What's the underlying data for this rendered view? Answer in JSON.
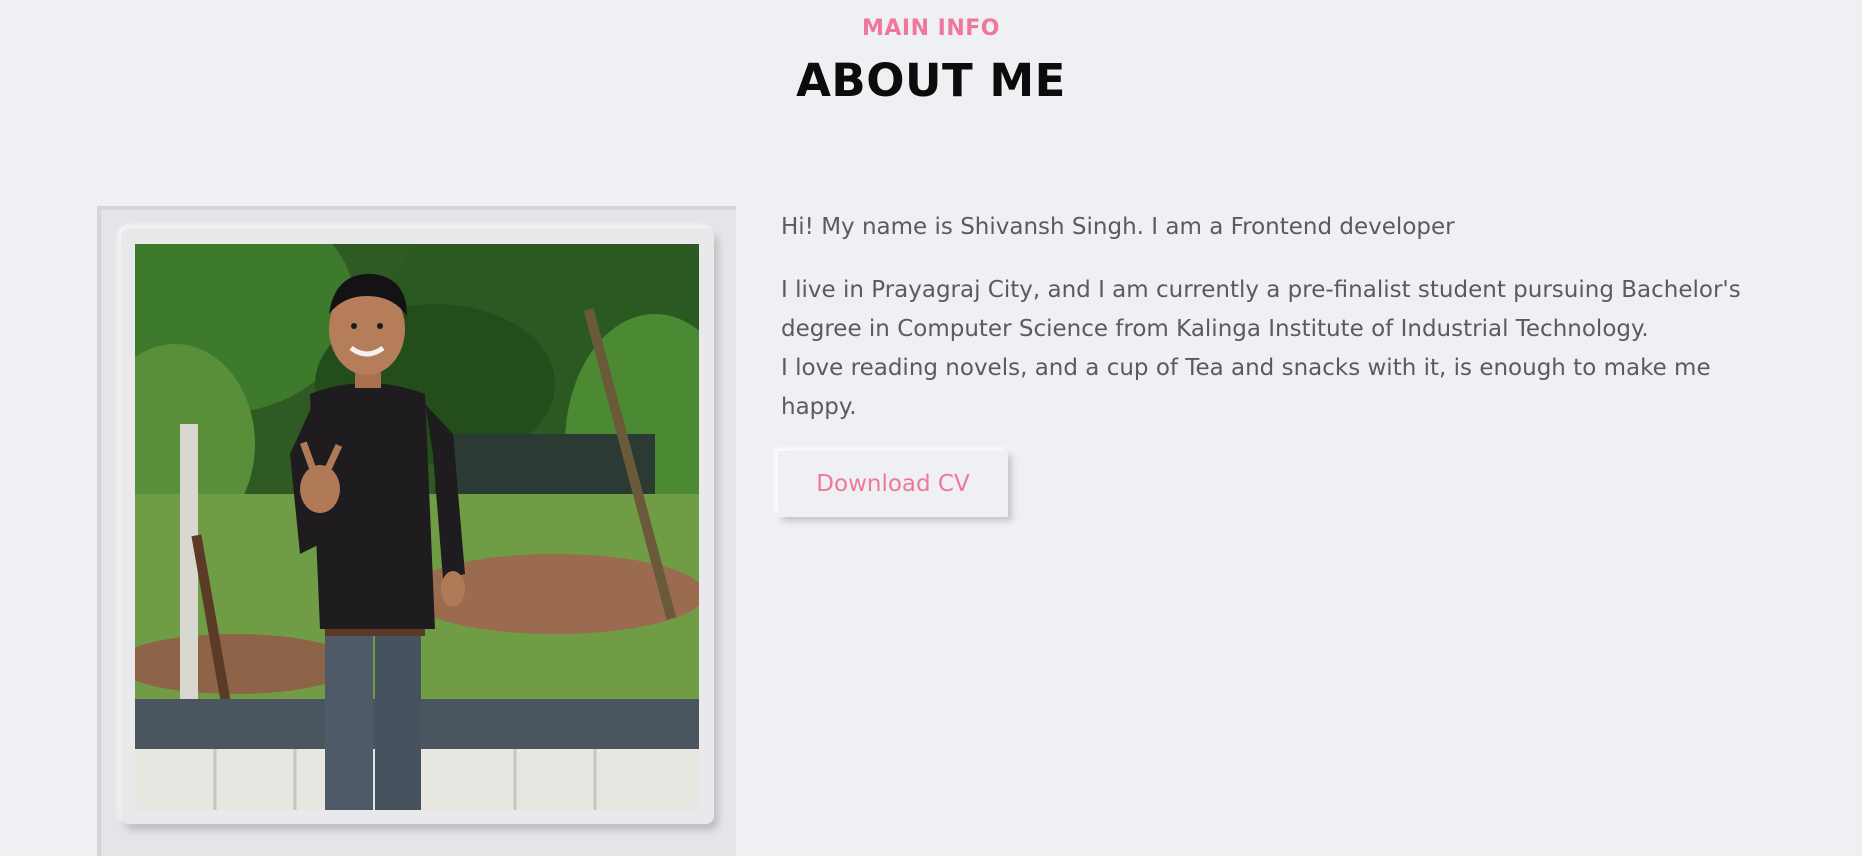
{
  "header": {
    "eyebrow": "MAIN INFO",
    "title": "ABOUT ME"
  },
  "about": {
    "intro": "Hi! My name is Shivansh Singh. I am a Frontend developer",
    "bio_line_1": "I live in Prayagraj City, and I am currently a pre-finalist student pursuing Bachelor's degree in Computer Science from Kalinga Institute of Industrial Technology.",
    "bio_line_2": "I love reading novels, and a cup of Tea and snacks with it, is enough to make me happy."
  },
  "actions": {
    "download_label": "Download CV"
  },
  "colors": {
    "accent": "#f0779c",
    "background": "#eff0f3",
    "text": "#5b5b5f"
  }
}
